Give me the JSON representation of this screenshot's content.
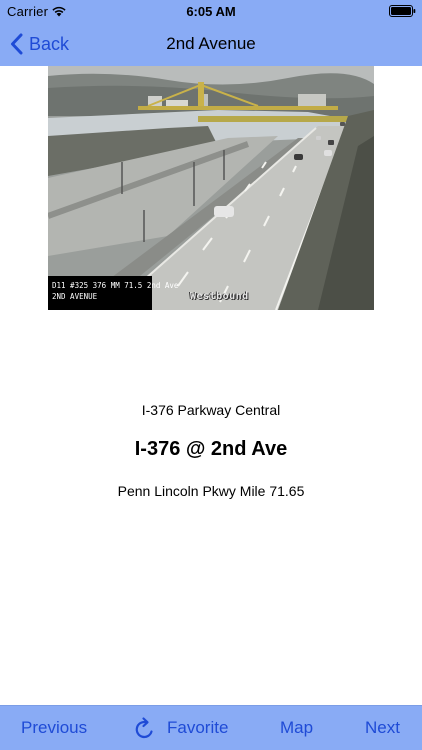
{
  "status_bar": {
    "carrier": "Carrier",
    "time": "6:05 AM",
    "icons": [
      "wifi-icon",
      "battery-icon"
    ]
  },
  "nav": {
    "back_label": "Back",
    "title": "2nd Avenue"
  },
  "camera": {
    "overlay_id_line1": "D11 #325 376 MM 71.5 2nd Ave",
    "overlay_id_line2": "2ND AVENUE",
    "overlay_direction": "Westbound"
  },
  "info": {
    "region": "I-376 Parkway Central",
    "name": "I-376 @ 2nd Ave",
    "location": "Penn Lincoln Pkwy Mile 71.65"
  },
  "toolbar": {
    "previous_label": "Previous",
    "favorite_label": "Favorite",
    "map_label": "Map",
    "next_label": "Next",
    "icons": [
      "refresh-icon"
    ]
  },
  "colors": {
    "bar_background": "#89abf5",
    "tint": "#1f4bd6"
  }
}
